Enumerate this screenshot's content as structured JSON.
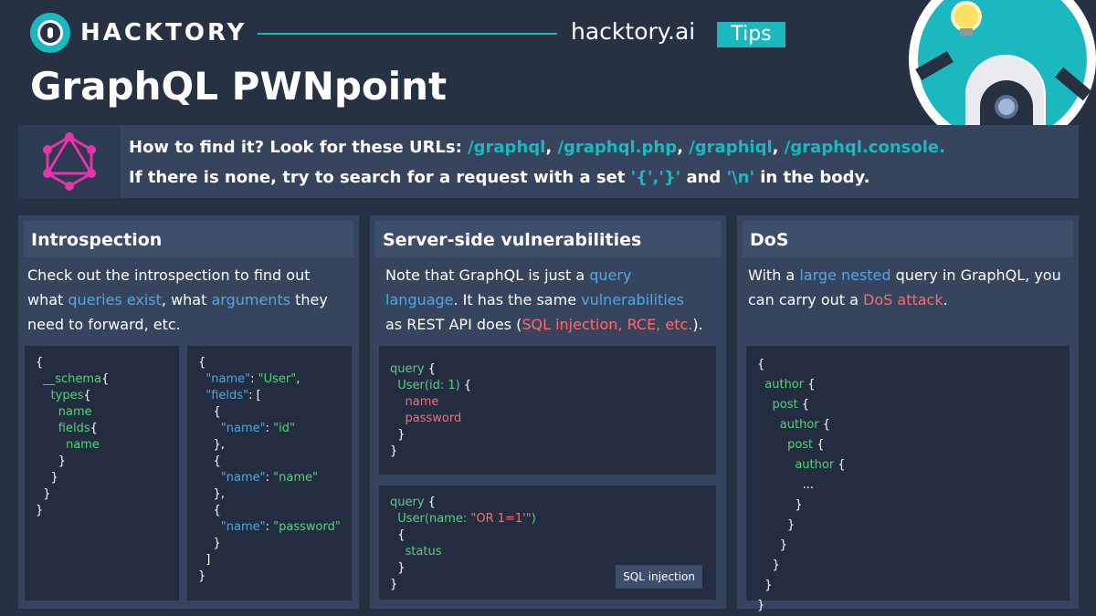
{
  "header": {
    "brand": "HACKTORY",
    "site": "hacktory.ai",
    "tag": "Tips",
    "title": "GraphQL PWNpoint"
  },
  "find": {
    "line1_prefix": "How to find it? Look for these URLs: ",
    "urls": [
      "/graphql",
      "/graphql.php",
      "/graphiql",
      "/graphql.console."
    ],
    "line2_a": "If there is none, try to search for a request with a set ",
    "braces": "'{','}'",
    "line2_b": " and ",
    "newline": "'\\n'",
    "line2_c": " in the body."
  },
  "panels": {
    "introspection": {
      "title": "Introspection",
      "desc_a": "Check out the introspection to find out",
      "desc_b": "what ",
      "link1": "queries exist",
      "desc_c": ", what ",
      "link2": "arguments",
      "desc_d": " they",
      "desc_e": "need to forward, etc."
    },
    "server": {
      "title": "Server-side vulnerabilities",
      "desc_a": "Note that GraphQL is just a ",
      "link1": "query",
      "link1b": "language",
      "desc_b": ". It has the same ",
      "link2": "vulnerabilities",
      "desc_c": "as REST API does (",
      "link3": "SQL injection, RCE, etc.",
      "desc_d": ").",
      "badge": "SQL injection"
    },
    "dos": {
      "title": "DoS",
      "desc_a": "With a ",
      "link1": "large nested",
      "desc_b": " query in GraphQL, you",
      "desc_c": "can carry out a ",
      "link2": "DoS attack",
      "desc_d": "."
    }
  },
  "colors": {
    "accent": "#1bb8bf",
    "link": "#4fa8e8",
    "danger": "#ff6b6b",
    "code_green": "#55d080"
  }
}
